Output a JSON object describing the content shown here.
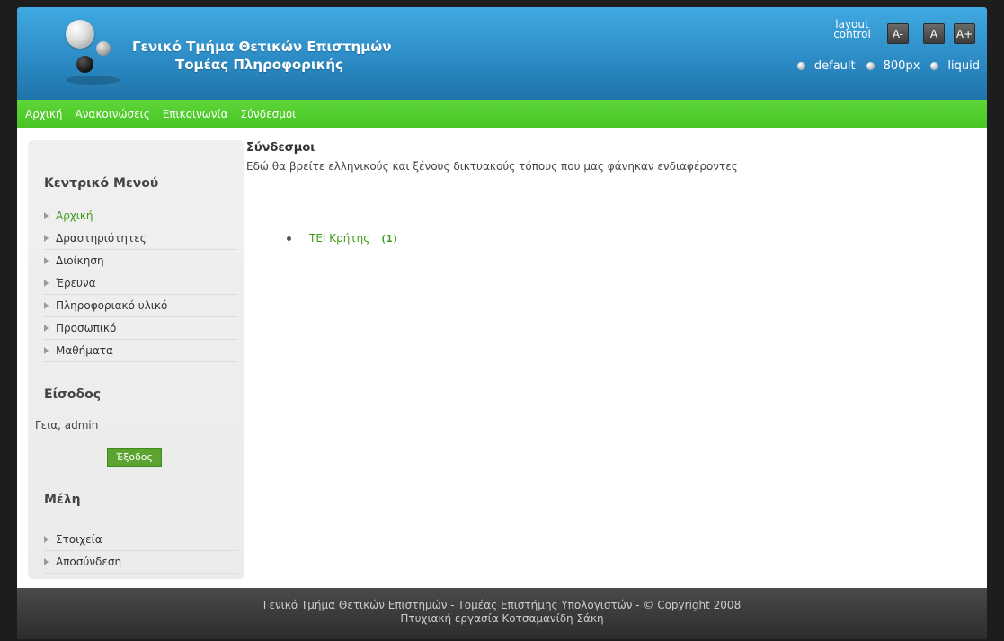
{
  "header": {
    "title_line1": "Γενικό Τμήμα Θετικών Επιστημών",
    "title_line2": "Τομέας Πληροφορικής",
    "layout_control_label": "layout control",
    "font_buttons": [
      "A-",
      "A",
      "A+"
    ],
    "width_options": [
      "default",
      "800px",
      "liquid"
    ]
  },
  "nav": {
    "items": [
      "Αρχική",
      "Ανακοινώσεις",
      "Επικοινωνία",
      "Σύνδεσμοι"
    ]
  },
  "sidebar": {
    "menu_heading": "Κεντρικό Μενού",
    "menu_items": [
      "Αρχική",
      "Δραστηριότητες",
      "Διοίκηση",
      "Έρευνα",
      "Πληροφοριακό υλικό",
      "Προσωπικό",
      "Μαθήματα"
    ],
    "login_heading": "Είσοδος",
    "greeting": "Γεια, admin",
    "logout_label": "Έξοδος",
    "members_heading": "Μέλη",
    "members_items": [
      "Στοιχεία",
      "Αποσύνδεση"
    ]
  },
  "main": {
    "title": "Σύνδεσμοι",
    "description": "Εδώ θα βρείτε ελληνικούς και ξένους δικτυακούς τόπους που μας φάνηκαν ενδιαφέροντες",
    "links": [
      {
        "label": "ΤΕΙ Κρήτης",
        "count": "(1)"
      }
    ]
  },
  "footer": {
    "line1": "Γενικό Τμήμα Θετικών Επιστημών - Τομέας Επιστήμης Υπολογιστών - © Copyright 2008",
    "line2": "Πτυχιακή εργασία Κοτσαμανίδη Σάκη"
  },
  "colors": {
    "header_blue": "#2d8cc6",
    "nav_green": "#4ec628",
    "link_green": "#3c9a17",
    "footer_dark": "#333333"
  }
}
